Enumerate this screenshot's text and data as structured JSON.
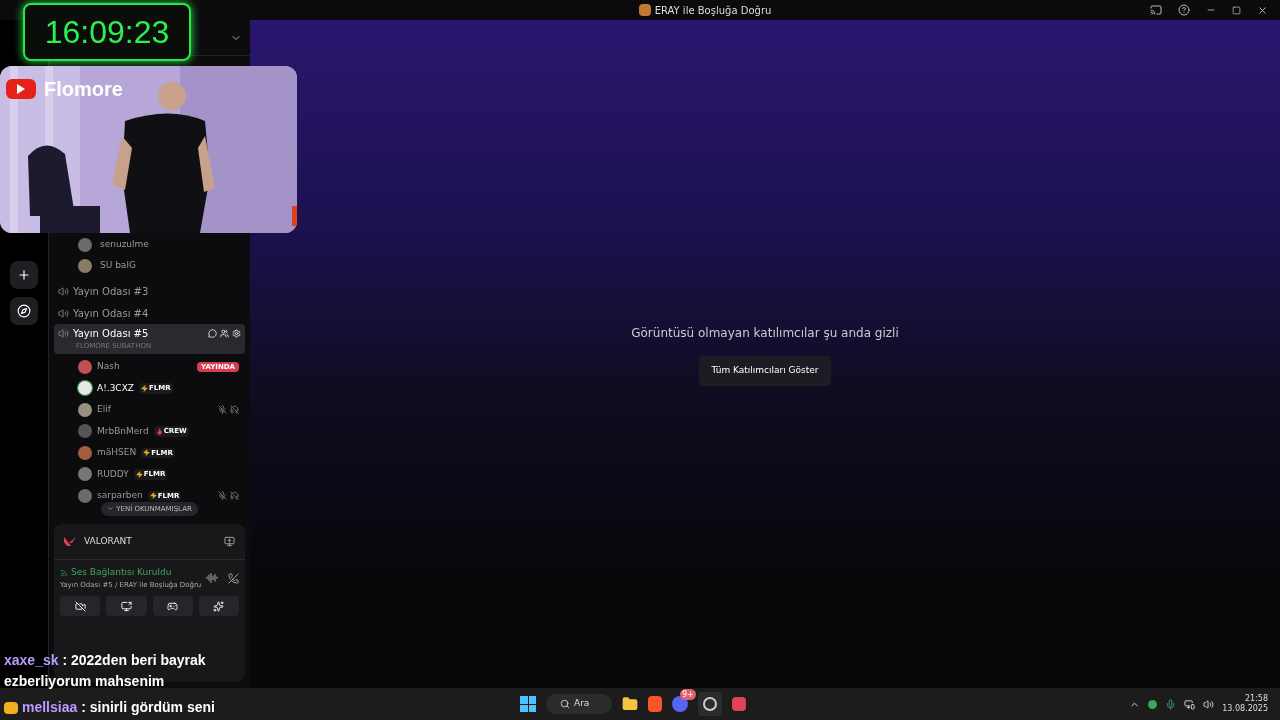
{
  "titlebar": {
    "title": "ERAY ile Boşluğa Doğru"
  },
  "timer": {
    "text": "16:09:23"
  },
  "webcam": {
    "channel": "Flomore"
  },
  "voice_members_top": [
    {
      "name": "senuzulme"
    },
    {
      "name": "SU balG"
    }
  ],
  "channels": [
    {
      "name": "Yayın Odası #3",
      "selected": false
    },
    {
      "name": "Yayın Odası #4",
      "selected": false
    },
    {
      "name": "Yayın Odası #5",
      "selected": true,
      "subtitle": "FLOMORE SUBATHON"
    }
  ],
  "members": [
    {
      "name": "Nash",
      "live": "YAYINDA",
      "muted": false
    },
    {
      "name": "A!.3CXZ",
      "tag": {
        "kind": "bolt",
        "text": "FLMR"
      },
      "muted": false,
      "speaking": true
    },
    {
      "name": "Elif",
      "muted": true
    },
    {
      "name": "MrbBnMerd",
      "tag": {
        "kind": "fire",
        "text": "CREW"
      },
      "muted": false
    },
    {
      "name": "mäHSEN",
      "tag": {
        "kind": "bolt",
        "text": "FLMR"
      },
      "muted": false
    },
    {
      "name": "RUDDY",
      "tag": {
        "kind": "bolt",
        "text": "FLMR"
      },
      "muted": false
    },
    {
      "name": "sarparben",
      "tag": {
        "kind": "bolt",
        "text": "FLMR"
      },
      "muted": true
    }
  ],
  "unread_pill": "YENİ OKUNMAMIŞLAR",
  "activity": {
    "name": "VALORANT"
  },
  "voice_status": {
    "title": "Ses Bağlantısı Kuruldu",
    "subtitle": "Yayın Odası #5 / ERAY ile Boşluğa Doğru"
  },
  "main": {
    "message": "Görüntüsü olmayan katılımcılar şu anda gizli",
    "button": "Tüm Katılımcıları Göster"
  },
  "chat": [
    {
      "user": "xaxe_sk",
      "text": ": 2022den beri bayrak ezberliyorum mahsenim"
    },
    {
      "user": "mellsiaa",
      "text": ": sinirli gördüm seni"
    }
  ],
  "taskbar": {
    "search": "Ara",
    "discord_badge": "9+",
    "time": "21:58",
    "date": "13.08.2025"
  }
}
